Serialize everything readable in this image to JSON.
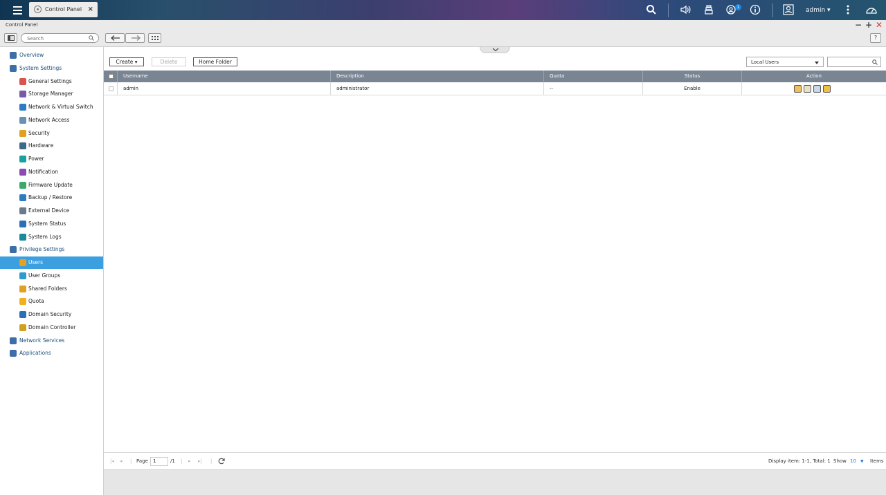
{
  "topbar": {
    "app_tab_label": "Control Panel",
    "notification_badge": "1",
    "user_label": "admin ▾"
  },
  "window": {
    "title": "Control Panel",
    "minimize": "−",
    "maximize": "+",
    "close": "✕"
  },
  "toolbar": {
    "search_placeholder": "Search",
    "help": "?"
  },
  "sidebar": {
    "items": [
      {
        "label": "Overview",
        "level": "top",
        "icon_color": "#3c6ea8"
      },
      {
        "label": "System Settings",
        "level": "top",
        "icon_color": "#3c6ea8"
      },
      {
        "label": "General Settings",
        "level": "sub",
        "icon_color": "#d9534f"
      },
      {
        "label": "Storage Manager",
        "level": "sub",
        "icon_color": "#7a5aa6"
      },
      {
        "label": "Network & Virtual Switch",
        "level": "sub",
        "icon_color": "#2f7ac0"
      },
      {
        "label": "Network Access",
        "level": "sub",
        "icon_color": "#6a8fb5"
      },
      {
        "label": "Security",
        "level": "sub",
        "icon_color": "#e0a020"
      },
      {
        "label": "Hardware",
        "level": "sub",
        "icon_color": "#3a6b8a"
      },
      {
        "label": "Power",
        "level": "sub",
        "icon_color": "#19a0a0"
      },
      {
        "label": "Notification",
        "level": "sub",
        "icon_color": "#8a4bb5"
      },
      {
        "label": "Firmware Update",
        "level": "sub",
        "icon_color": "#3da86b"
      },
      {
        "label": "Backup / Restore",
        "level": "sub",
        "icon_color": "#2e7bbd"
      },
      {
        "label": "External Device",
        "level": "sub",
        "icon_color": "#6b7a8a"
      },
      {
        "label": "System Status",
        "level": "sub",
        "icon_color": "#2c6fb5"
      },
      {
        "label": "System Logs",
        "level": "sub",
        "icon_color": "#1a8a9a"
      },
      {
        "label": "Privilege Settings",
        "level": "top",
        "icon_color": "#3c6ea8"
      },
      {
        "label": "Users",
        "level": "sub",
        "icon_color": "#e8a020",
        "active": true
      },
      {
        "label": "User Groups",
        "level": "sub",
        "icon_color": "#2e9ad0"
      },
      {
        "label": "Shared Folders",
        "level": "sub",
        "icon_color": "#e0a020"
      },
      {
        "label": "Quota",
        "level": "sub",
        "icon_color": "#f0b020"
      },
      {
        "label": "Domain Security",
        "level": "sub",
        "icon_color": "#2a6fb8"
      },
      {
        "label": "Domain Controller",
        "level": "sub",
        "icon_color": "#d0a020"
      },
      {
        "label": "Network Services",
        "level": "top",
        "icon_color": "#3c6ea8"
      },
      {
        "label": "Applications",
        "level": "top",
        "icon_color": "#3c6ea8"
      }
    ]
  },
  "actions": {
    "create": "Create ▾",
    "delete": "Delete",
    "home_folder": "Home Folder",
    "user_type": "Local Users"
  },
  "table": {
    "columns": [
      "Username",
      "Description",
      "Quota",
      "Status",
      "Action"
    ],
    "rows": [
      {
        "username": "admin",
        "description": "administrator",
        "quota": "--",
        "status": "Enable"
      }
    ]
  },
  "pager": {
    "page_label": "Page",
    "page_value": "1",
    "page_total": "/1",
    "display_info": "Display item: 1-1, Total: 1",
    "show_label": "Show",
    "show_value": "10",
    "items_label": "Items"
  },
  "colors": {
    "accent": "#3b9fe0",
    "table_header": "#7a8593",
    "link": "#1d4f7a"
  }
}
